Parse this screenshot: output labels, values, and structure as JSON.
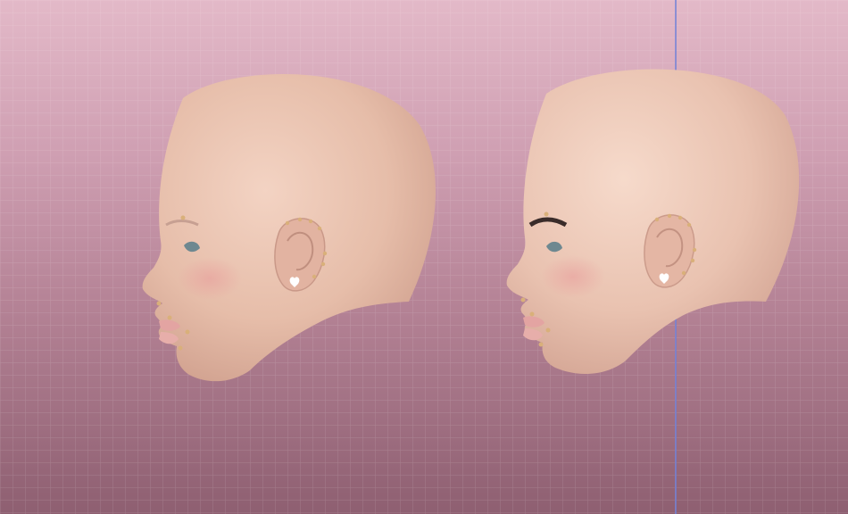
{
  "viewport": {
    "background_top": "#e3b9c8",
    "background_bottom": "#8e5f71",
    "grid_line_color": "#ffffff",
    "axis_line_color": "#6f7fd6"
  },
  "models": [
    {
      "name": "head-left",
      "view": "side-profile",
      "eyebrow": "light",
      "skin_color": "#e8c3b2"
    },
    {
      "name": "head-right",
      "view": "side-profile",
      "eyebrow": "dark",
      "skin_color": "#ecc8b8"
    }
  ],
  "accessories": [
    "ear-piercings",
    "nose-ring",
    "lip-piercing",
    "freckles"
  ]
}
